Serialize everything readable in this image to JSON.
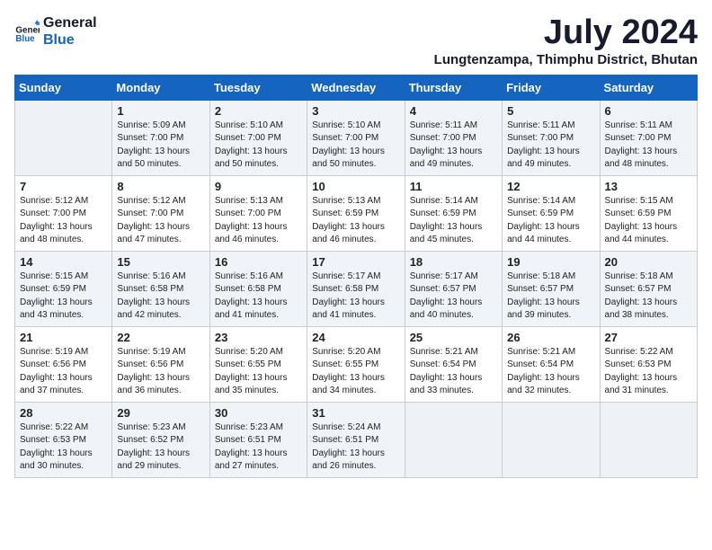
{
  "logo": {
    "line1": "General",
    "line2": "Blue"
  },
  "title": "July 2024",
  "location": "Lungtenzampa, Thimphu District, Bhutan",
  "days_of_week": [
    "Sunday",
    "Monday",
    "Tuesday",
    "Wednesday",
    "Thursday",
    "Friday",
    "Saturday"
  ],
  "weeks": [
    [
      {
        "day": "",
        "info": ""
      },
      {
        "day": "1",
        "info": "Sunrise: 5:09 AM\nSunset: 7:00 PM\nDaylight: 13 hours\nand 50 minutes."
      },
      {
        "day": "2",
        "info": "Sunrise: 5:10 AM\nSunset: 7:00 PM\nDaylight: 13 hours\nand 50 minutes."
      },
      {
        "day": "3",
        "info": "Sunrise: 5:10 AM\nSunset: 7:00 PM\nDaylight: 13 hours\nand 50 minutes."
      },
      {
        "day": "4",
        "info": "Sunrise: 5:11 AM\nSunset: 7:00 PM\nDaylight: 13 hours\nand 49 minutes."
      },
      {
        "day": "5",
        "info": "Sunrise: 5:11 AM\nSunset: 7:00 PM\nDaylight: 13 hours\nand 49 minutes."
      },
      {
        "day": "6",
        "info": "Sunrise: 5:11 AM\nSunset: 7:00 PM\nDaylight: 13 hours\nand 48 minutes."
      }
    ],
    [
      {
        "day": "7",
        "info": "Sunrise: 5:12 AM\nSunset: 7:00 PM\nDaylight: 13 hours\nand 48 minutes."
      },
      {
        "day": "8",
        "info": "Sunrise: 5:12 AM\nSunset: 7:00 PM\nDaylight: 13 hours\nand 47 minutes."
      },
      {
        "day": "9",
        "info": "Sunrise: 5:13 AM\nSunset: 7:00 PM\nDaylight: 13 hours\nand 46 minutes."
      },
      {
        "day": "10",
        "info": "Sunrise: 5:13 AM\nSunset: 6:59 PM\nDaylight: 13 hours\nand 46 minutes."
      },
      {
        "day": "11",
        "info": "Sunrise: 5:14 AM\nSunset: 6:59 PM\nDaylight: 13 hours\nand 45 minutes."
      },
      {
        "day": "12",
        "info": "Sunrise: 5:14 AM\nSunset: 6:59 PM\nDaylight: 13 hours\nand 44 minutes."
      },
      {
        "day": "13",
        "info": "Sunrise: 5:15 AM\nSunset: 6:59 PM\nDaylight: 13 hours\nand 44 minutes."
      }
    ],
    [
      {
        "day": "14",
        "info": "Sunrise: 5:15 AM\nSunset: 6:59 PM\nDaylight: 13 hours\nand 43 minutes."
      },
      {
        "day": "15",
        "info": "Sunrise: 5:16 AM\nSunset: 6:58 PM\nDaylight: 13 hours\nand 42 minutes."
      },
      {
        "day": "16",
        "info": "Sunrise: 5:16 AM\nSunset: 6:58 PM\nDaylight: 13 hours\nand 41 minutes."
      },
      {
        "day": "17",
        "info": "Sunrise: 5:17 AM\nSunset: 6:58 PM\nDaylight: 13 hours\nand 41 minutes."
      },
      {
        "day": "18",
        "info": "Sunrise: 5:17 AM\nSunset: 6:57 PM\nDaylight: 13 hours\nand 40 minutes."
      },
      {
        "day": "19",
        "info": "Sunrise: 5:18 AM\nSunset: 6:57 PM\nDaylight: 13 hours\nand 39 minutes."
      },
      {
        "day": "20",
        "info": "Sunrise: 5:18 AM\nSunset: 6:57 PM\nDaylight: 13 hours\nand 38 minutes."
      }
    ],
    [
      {
        "day": "21",
        "info": "Sunrise: 5:19 AM\nSunset: 6:56 PM\nDaylight: 13 hours\nand 37 minutes."
      },
      {
        "day": "22",
        "info": "Sunrise: 5:19 AM\nSunset: 6:56 PM\nDaylight: 13 hours\nand 36 minutes."
      },
      {
        "day": "23",
        "info": "Sunrise: 5:20 AM\nSunset: 6:55 PM\nDaylight: 13 hours\nand 35 minutes."
      },
      {
        "day": "24",
        "info": "Sunrise: 5:20 AM\nSunset: 6:55 PM\nDaylight: 13 hours\nand 34 minutes."
      },
      {
        "day": "25",
        "info": "Sunrise: 5:21 AM\nSunset: 6:54 PM\nDaylight: 13 hours\nand 33 minutes."
      },
      {
        "day": "26",
        "info": "Sunrise: 5:21 AM\nSunset: 6:54 PM\nDaylight: 13 hours\nand 32 minutes."
      },
      {
        "day": "27",
        "info": "Sunrise: 5:22 AM\nSunset: 6:53 PM\nDaylight: 13 hours\nand 31 minutes."
      }
    ],
    [
      {
        "day": "28",
        "info": "Sunrise: 5:22 AM\nSunset: 6:53 PM\nDaylight: 13 hours\nand 30 minutes."
      },
      {
        "day": "29",
        "info": "Sunrise: 5:23 AM\nSunset: 6:52 PM\nDaylight: 13 hours\nand 29 minutes."
      },
      {
        "day": "30",
        "info": "Sunrise: 5:23 AM\nSunset: 6:51 PM\nDaylight: 13 hours\nand 27 minutes."
      },
      {
        "day": "31",
        "info": "Sunrise: 5:24 AM\nSunset: 6:51 PM\nDaylight: 13 hours\nand 26 minutes."
      },
      {
        "day": "",
        "info": ""
      },
      {
        "day": "",
        "info": ""
      },
      {
        "day": "",
        "info": ""
      }
    ]
  ]
}
